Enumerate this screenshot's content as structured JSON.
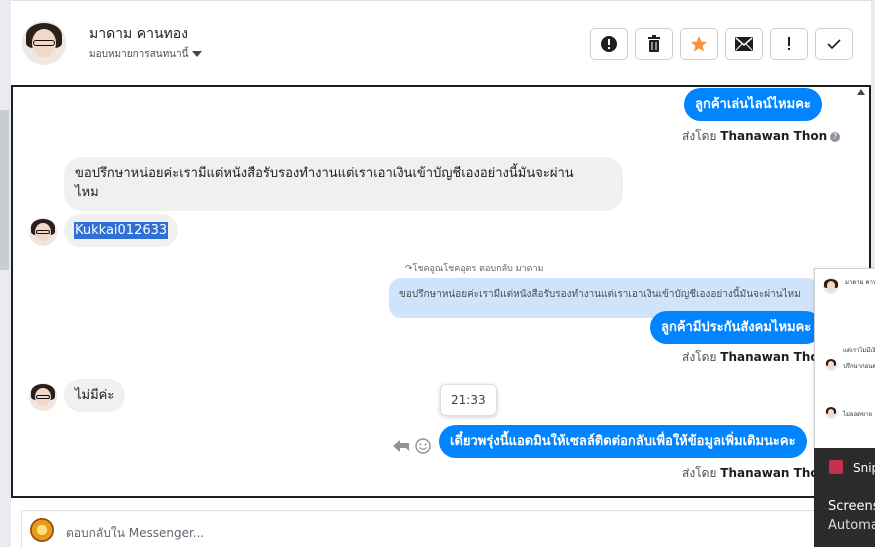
{
  "header": {
    "contact_name": "มาดาม คานทอง",
    "assign_label": "มอบหมายการสนทนานี้",
    "actions": [
      {
        "name": "spam-report-button",
        "icon": "exclamation-circle-icon",
        "color": "#1c1e21"
      },
      {
        "name": "delete-button",
        "icon": "trash-icon",
        "color": "#1c1e21"
      },
      {
        "name": "star-button",
        "icon": "star-icon",
        "color": "#f7923a"
      },
      {
        "name": "mark-unread-button",
        "icon": "envelope-icon",
        "color": "#1c1e21"
      },
      {
        "name": "follow-up-button",
        "icon": "exclamation-icon",
        "color": "#1c1e21"
      },
      {
        "name": "mark-done-button",
        "icon": "checkmark-icon",
        "color": "#1c1e21"
      }
    ]
  },
  "messages": {
    "m1": "ลูกค้าเล่นไลน์ไหมคะ",
    "sent1_prefix": "ส่งโดย",
    "sent1_name": "Thanawan Thon",
    "m2": "ขอปรึกษาหน่อยค่ะเรามีแต่หนังสือรับรองทำงานแต่เราเอาเงินเข้าบัญชีเองอย่างนี้มันจะผ่าน\nไหม",
    "m3": "Kukkai012633",
    "reply_meta": "โชคอูณโชคอุดร ตอบกลับ มาดาม",
    "quote": "ขอปรึกษาหน่อยค่ะเรามีแต่หนังสือรับรองทำงานแต่เราเอาเงินเข้าบัญชีเองอย่างนี้มันจะผ่านไหม",
    "m4": "ลูกค้ามีประกันสังคมไหมคะ",
    "sent2_prefix": "ส่งโดย",
    "sent2_name": "Thanawan Thon",
    "m5": "ไม่มีค่ะ",
    "time_tooltip": "21:33",
    "m6": "เดี๋ยวพรุ่งนี้แอดมินให้เซลล์ติดต่อกลับเพื่อให้ข้อมูลเพิ่มเติมนะคะ",
    "sent3_prefix": "ส่งโดย",
    "sent3_name": "Thanawan Thon"
  },
  "composer": {
    "placeholder": "ตอบกลับใน Messenger..."
  },
  "side_panel": {
    "line1": "มาดาม คานทอง",
    "line2": "แต่เราไม่มีเงิน",
    "line3": "ปรึกษาก่อนค่ะ",
    "line4": "ไม่ยอดขาย"
  },
  "snip_notification": {
    "title": "Snip",
    "line1": "Screens",
    "line2": "Automa"
  },
  "colors": {
    "outgoing_bubble": "#0084ff",
    "incoming_bubble": "#f1f0f0",
    "quote_bubble": "#cfe4fb",
    "highlight": "#2f6fd6"
  }
}
